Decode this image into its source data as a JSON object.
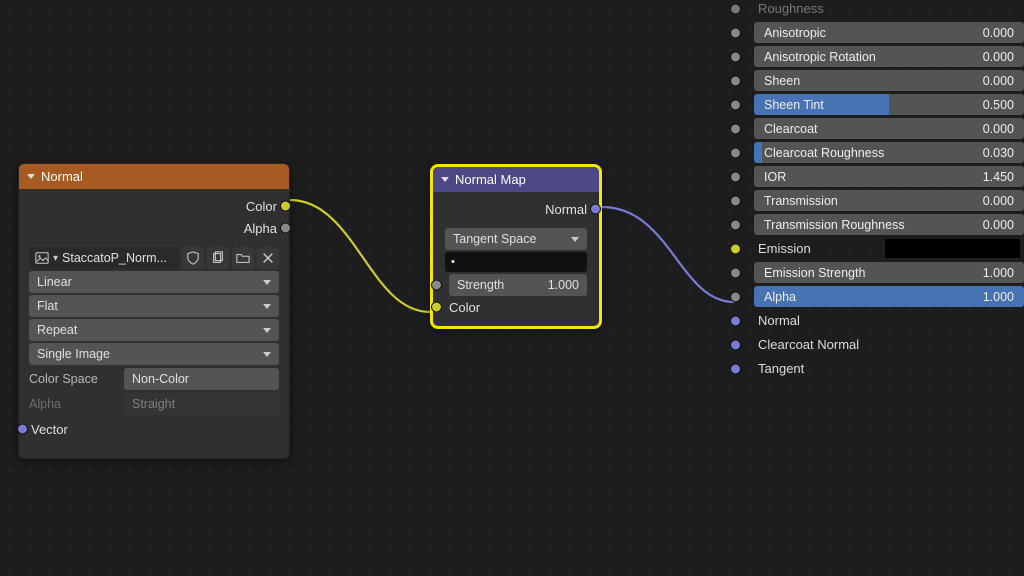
{
  "texture_node": {
    "title": "Normal",
    "out_color": "Color",
    "out_alpha": "Alpha",
    "image_name": "StaccatoP_Norm...",
    "interp": "Linear",
    "projection": "Flat",
    "extension": "Repeat",
    "source": "Single Image",
    "colorspace_label": "Color Space",
    "colorspace_value": "Non-Color",
    "alpha_label": "Alpha",
    "alpha_value": "Straight",
    "in_vector": "Vector"
  },
  "nmap_node": {
    "title": "Normal Map",
    "out_normal": "Normal",
    "space": "Tangent Space",
    "uvmap": "•",
    "strength_label": "Strength",
    "strength_value": "1.000",
    "in_color": "Color"
  },
  "bsdf": {
    "roughness": {
      "label": "Roughness"
    },
    "anisotropic": {
      "label": "Anisotropic",
      "value": "0.000"
    },
    "anisotropic_rotation": {
      "label": "Anisotropic Rotation",
      "value": "0.000"
    },
    "sheen": {
      "label": "Sheen",
      "value": "0.000"
    },
    "sheen_tint": {
      "label": "Sheen Tint",
      "value": "0.500"
    },
    "clearcoat": {
      "label": "Clearcoat",
      "value": "0.000"
    },
    "clearcoat_roughness": {
      "label": "Clearcoat Roughness",
      "value": "0.030"
    },
    "ior": {
      "label": "IOR",
      "value": "1.450"
    },
    "transmission": {
      "label": "Transmission",
      "value": "0.000"
    },
    "transmission_roughness": {
      "label": "Transmission Roughness",
      "value": "0.000"
    },
    "emission": {
      "label": "Emission"
    },
    "emission_strength": {
      "label": "Emission Strength",
      "value": "1.000"
    },
    "alpha": {
      "label": "Alpha",
      "value": "1.000"
    },
    "normal": {
      "label": "Normal"
    },
    "clearcoat_normal": {
      "label": "Clearcoat Normal"
    },
    "tangent": {
      "label": "Tangent"
    }
  }
}
